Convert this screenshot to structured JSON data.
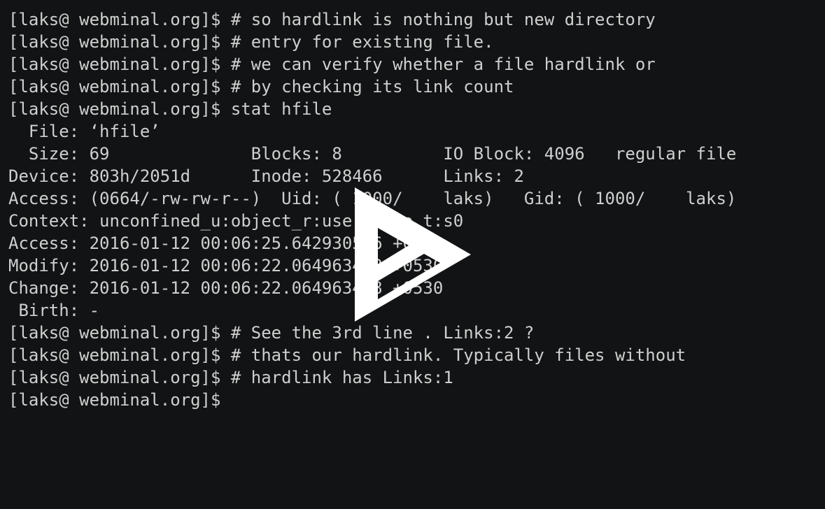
{
  "terminal": {
    "background_color": "#121314",
    "text_color": "#cfcfcf",
    "lines": [
      "[laks@ webminal.org]$ # so hardlink is nothing but new directory",
      "[laks@ webminal.org]$ # entry for existing file.",
      "[laks@ webminal.org]$ # we can verify whether a file hardlink or",
      "[laks@ webminal.org]$ # by checking its link count",
      "[laks@ webminal.org]$ stat hfile",
      "  File: ‘hfile’",
      "  Size: 69              Blocks: 8          IO Block: 4096   regular file",
      "Device: 803h/2051d      Inode: 528466      Links: 2",
      "Access: (0664/-rw-rw-r--)  Uid: ( 1000/    laks)   Gid: ( 1000/    laks)",
      "Context: unconfined_u:object_r:user_home_t:s0",
      "Access: 2016-01-12 00:06:25.642930576 +0530",
      "Modify: 2016-01-12 00:06:22.064963448 +0530",
      "Change: 2016-01-12 00:06:22.064963448 +0530",
      " Birth: -",
      "[laks@ webminal.org]$ # See the 3rd line . Links:2 ?",
      "[laks@ webminal.org]$ # thats our hardlink. Typically files without",
      "[laks@ webminal.org]$ # hardlink has Links:1",
      "[laks@ webminal.org]$ "
    ]
  },
  "overlay": {
    "icon": "asciinema-play-icon",
    "color": "#ffffff"
  }
}
